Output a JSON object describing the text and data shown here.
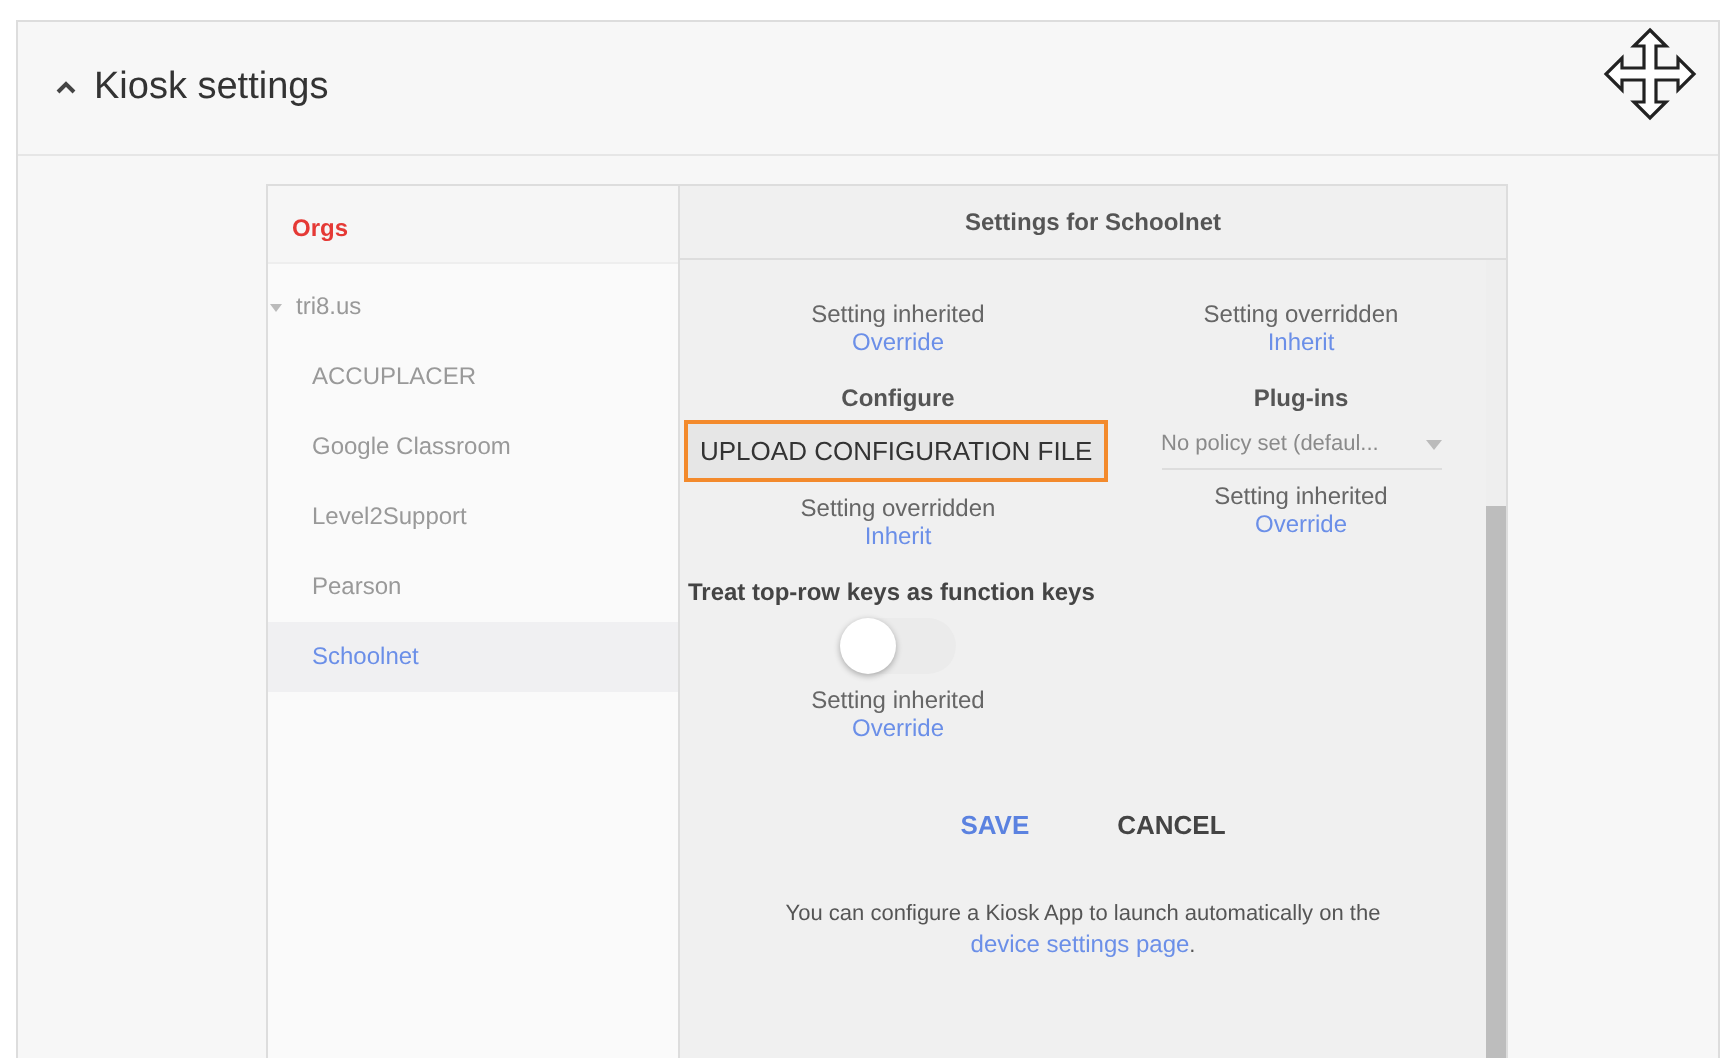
{
  "section": {
    "title": "Kiosk settings",
    "expanded": true
  },
  "orgs": {
    "heading": "Orgs",
    "tree": [
      {
        "label": "tri8.us",
        "expanded": true,
        "selected": false,
        "children": [
          {
            "label": "ACCUPLACER",
            "selected": false
          },
          {
            "label": "Google Classroom",
            "selected": false
          },
          {
            "label": "Level2Support",
            "selected": false
          },
          {
            "label": "Pearson",
            "selected": false
          },
          {
            "label": "Schoolnet",
            "selected": true
          }
        ]
      }
    ]
  },
  "settings": {
    "title": "Settings for Schoolnet",
    "rows": [
      [
        {
          "kind": "status",
          "status": "Setting inherited",
          "action": "Override"
        },
        {
          "kind": "status",
          "status": "Setting overridden",
          "action": "Inherit"
        }
      ],
      [
        {
          "kind": "upload",
          "label": "Configure",
          "button": "UPLOAD CONFIGURATION FILE",
          "highlighted": true,
          "status": "Setting overridden",
          "action": "Inherit"
        },
        {
          "kind": "select",
          "label": "Plug-ins",
          "value": "No policy set (defaul...",
          "status": "Setting inherited",
          "action": "Override"
        }
      ]
    ],
    "toggle": {
      "label": "Treat top-row keys as function keys",
      "on": false,
      "status": "Setting inherited",
      "action": "Override"
    },
    "buttons": [
      {
        "label": "SAVE",
        "kind": "primary"
      },
      {
        "label": "CANCEL",
        "kind": "secondary"
      }
    ],
    "note": {
      "text": "You can configure a Kiosk App to launch automatically on the",
      "link": "device settings page",
      "end": "."
    }
  }
}
